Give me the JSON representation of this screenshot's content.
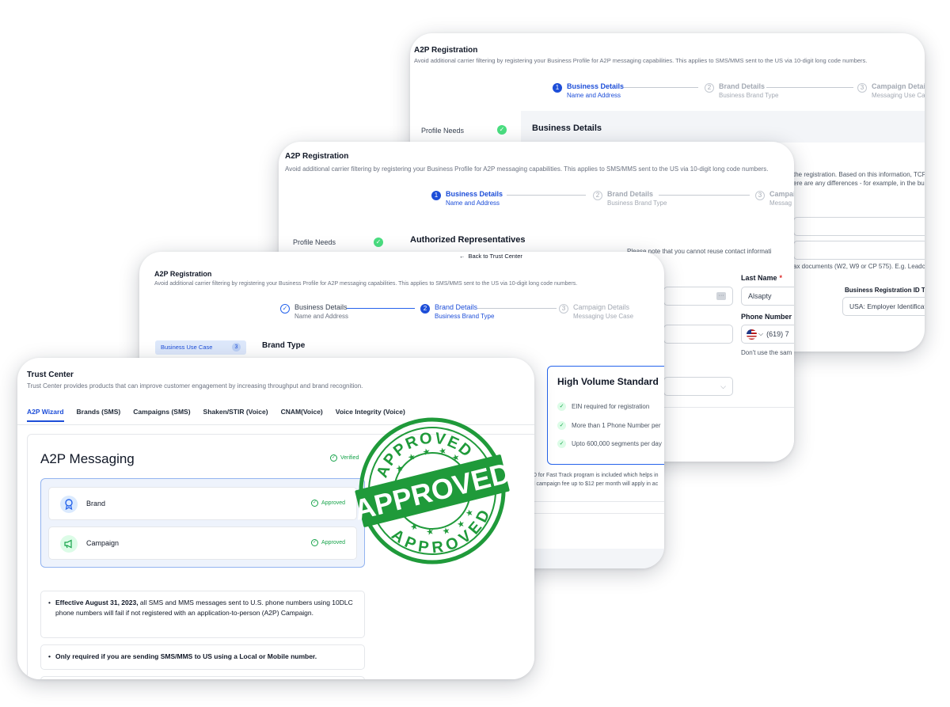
{
  "card_back": {
    "title": "A2P Registration",
    "subtitle": "Avoid additional carrier filtering by registering your Business Profile for A2P messaging capabilities. This applies to SMS/MMS sent to the US via 10-digit long code numbers.",
    "steps": [
      {
        "num": "1",
        "label": "Business Details",
        "sub": "Name and Address"
      },
      {
        "num": "2",
        "label": "Brand Details",
        "sub": "Business Brand Type"
      },
      {
        "num": "3",
        "label": "Campaign Details",
        "sub": "Messaging Use Case"
      }
    ],
    "side_label": "Profile Needs",
    "section_title": "Business Details",
    "desc_line1": "the registration. Based on this information, TCR",
    "desc_line2": "ere are any differences - for example, in the bus",
    "tax_line": "ax documents (W2, W9 or CP 575). E.g. Leadco",
    "reg_id_label": "Business Registration ID Typ",
    "reg_id_value": "USA: Employer Identificati"
  },
  "card_mid": {
    "title": "A2P Registration",
    "subtitle": "Avoid additional carrier filtering by registering your Business Profile for A2P messaging capabilities. This applies to SMS/MMS sent to the US via 10-digit long code numbers.",
    "steps": [
      {
        "num": "1",
        "label": "Business Details",
        "sub": "Name and Address"
      },
      {
        "num": "2",
        "label": "Brand Details",
        "sub": "Business Brand Type"
      },
      {
        "num": "3",
        "label": "Campai",
        "sub": "Messag"
      }
    ],
    "side_label": "Profile Needs",
    "section_title": "Authorized Representatives",
    "reuse_note": "Please note that you cannot reuse contact informati",
    "last_name_label": "Last Name",
    "last_name_value": "Alsapty",
    "phone_label": "Phone Number",
    "phone_value": "(619) 7",
    "phone_hint": "Don't use the sam",
    "required_mark": "*"
  },
  "card_third": {
    "back_link": "Back to Trust Center",
    "title": "A2P Registration",
    "subtitle": "Avoid additional carrier filtering by registering your Business Profile for A2P messaging capabilities. This applies to SMS/MMS sent to the US via 10-digit long code numbers.",
    "steps": [
      {
        "num": "✓",
        "label": "Business Details",
        "sub": "Name and Address"
      },
      {
        "num": "2",
        "label": "Brand Details",
        "sub": "Business Brand Type"
      },
      {
        "num": "3",
        "label": "Campaign Details",
        "sub": "Messaging Use Case"
      }
    ],
    "side_item": "Business Use Case",
    "side_item_badge": "3",
    "section_title": "Brand Type",
    "high_volume": {
      "title": "High Volume Standard",
      "items": [
        "EIN required for registration",
        "More than 1 Phone Number per",
        "Upto 600,000 segments per day"
      ]
    },
    "fast_track_line1": "0 for Fast Track program is included which helps in",
    "fast_track_line2": "l campaign fee up to $12 per month will apply in ac"
  },
  "card_front": {
    "title": "Trust Center",
    "subtitle": "Trust Center provides products that can improve customer engagement by increasing throughput and brand recognition.",
    "tabs": [
      "A2P Wizard",
      "Brands (SMS)",
      "Campaigns (SMS)",
      "Shaken/STIR (Voice)",
      "CNAM(Voice)",
      "Voice Integrity (Voice)"
    ],
    "panel_title": "A2P Messaging",
    "verified_label": "Verified",
    "rows": [
      {
        "label": "Brand",
        "status": "Approved",
        "icon": "ribbon-icon"
      },
      {
        "label": "Campaign",
        "status": "Approved",
        "icon": "megaphone-icon"
      }
    ],
    "note1_bold": "Effective August 31, 2023,",
    "note1_rest": " all SMS and MMS messages sent to U.S. phone numbers using 10DLC phone numbers will fail if not registered with an application-to-person (A2P) Campaign.",
    "note2": "Only required if you are sending SMS/MMS to US using a Local or Mobile number."
  },
  "stamp": {
    "main": "APPROVED",
    "top_arc": "APPROVED",
    "bottom_arc": "APPROVED",
    "color": "#1f9a3a"
  }
}
